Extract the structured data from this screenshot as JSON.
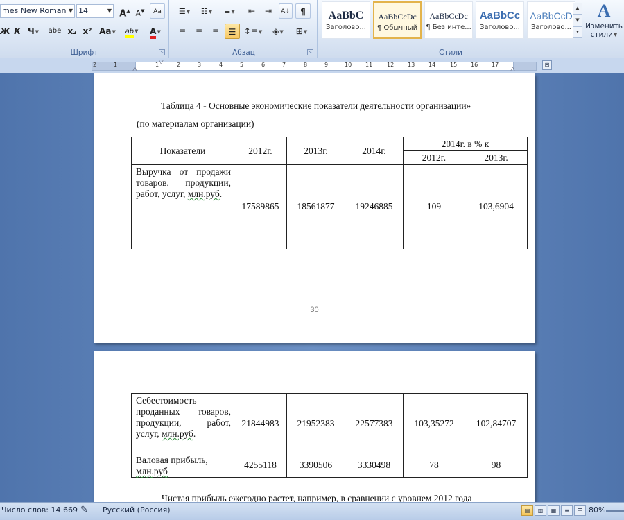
{
  "ribbon": {
    "font": {
      "name": "mes New Roman",
      "size": "14",
      "grow_icon": "A",
      "shrink_icon": "A",
      "clear_icon": "Aa",
      "bold": "Ж",
      "italic": "К",
      "underline": "Ч",
      "strike": "abe",
      "subscript": "x₂",
      "superscript": "x²",
      "case": "Aa",
      "highlight": "ab",
      "font_color": "A",
      "group_label": "Шрифт"
    },
    "paragraph": {
      "show_marks": "¶",
      "group_label": "Абзац"
    },
    "styles": {
      "items": [
        {
          "sample": "AaBbC",
          "name": "Заголово..."
        },
        {
          "sample": "AaBbCcDc",
          "name": "¶ Обычный"
        },
        {
          "sample": "AaBbCcDc",
          "name": "¶ Без инте..."
        },
        {
          "sample": "AaBbCc",
          "name": "Заголово..."
        },
        {
          "sample": "AaBbCcD",
          "name": "Заголово..."
        }
      ],
      "group_label": "Стили",
      "change_label_1": "Изменить",
      "change_label_2": "стили"
    }
  },
  "ruler": {
    "numbers": [
      "2",
      "1",
      "1",
      "2",
      "3",
      "4",
      "5",
      "6",
      "7",
      "8",
      "9",
      "10",
      "11",
      "12",
      "13",
      "14",
      "15",
      "16",
      "17"
    ]
  },
  "page1": {
    "caption": "Таблица 4 - Основные экономические показатели деятельности организации»",
    "caption_sub": "(по материалам организации)",
    "page_number": "30",
    "table": {
      "h_indicators": "Показатели",
      "h_2012": "2012г.",
      "h_2013": "2013г.",
      "h_2014": "2014г.",
      "h_pct": "2014г. в % к",
      "h_pct_2012": "2012г.",
      "h_pct_2013": "2013г.",
      "row1": {
        "label": "Выручка от продажи товаров, продукции, работ, услуг, млн.руб.",
        "v2012": "17589865",
        "v2013": "18561877",
        "v2014": "19246885",
        "p2012": "109",
        "p2013": "103,6904"
      }
    }
  },
  "page2": {
    "table": {
      "row2": {
        "label": "Себестоимость проданных товаров, продукции, работ, услуг, млн.руб.",
        "v2012": "21844983",
        "v2013": "21952383",
        "v2014": "22577383",
        "p2012": "103,35272",
        "p2013": "102,84707"
      },
      "row3": {
        "label": "Валовая прибыль, млн.руб",
        "v2012": "4255118",
        "v2013": "3390506",
        "v2014": "3330498",
        "p2012": "78",
        "p2013": "98"
      }
    },
    "cut_text": "Чистая прибыль ежегодно растет, например, в сравнении с уровнем 2012 года"
  },
  "status": {
    "word_count": "Число слов: 14 669",
    "language": "Русский (Россия)",
    "zoom": "80%"
  },
  "colors": {
    "ribbon_bg": "#dfe9f6",
    "workspace_bg": "#5b7fb4",
    "highlight_yellow": "#ffff00",
    "font_color_red": "#e02020"
  }
}
